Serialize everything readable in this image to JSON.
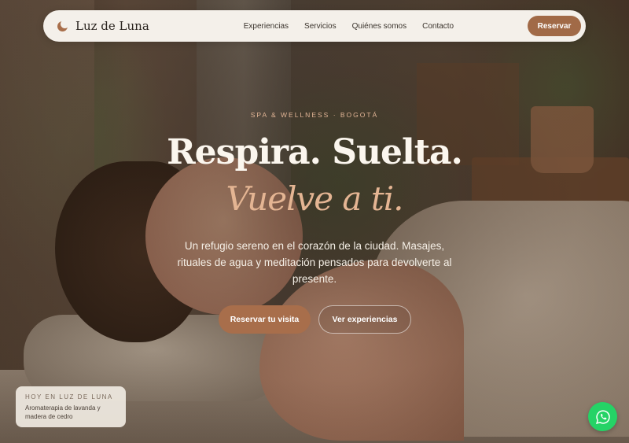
{
  "nav": {
    "logo": "Luz de Luna",
    "links": [
      "Experiencias",
      "Servicios",
      "Quiénes somos",
      "Contacto"
    ],
    "cta": "Reservar"
  },
  "hero": {
    "eyebrow": "SPA & WELLNESS · BOGOTÁ",
    "headline": "Respira. Suelta.",
    "headline_accent": "Vuelve a ti.",
    "subtitle": "Un refugio sereno en el corazón de la ciudad. Masajes, rituales de agua y meditación pensados para devolverte al presente.",
    "primary_button": "Reservar tu visita",
    "secondary_button": "Ver experiencias"
  },
  "today_card": {
    "label": "HOY EN LUZ DE LUNA",
    "text": "Aromaterapia de lavanda y madera de cedro"
  },
  "colors": {
    "accent": "#a86e4b",
    "accent_text": "#e4b593",
    "nav_bg": "#f4f0ea",
    "whatsapp": "#25d366"
  },
  "icons": {
    "logo": "moon-icon",
    "chat": "whatsapp-icon"
  }
}
